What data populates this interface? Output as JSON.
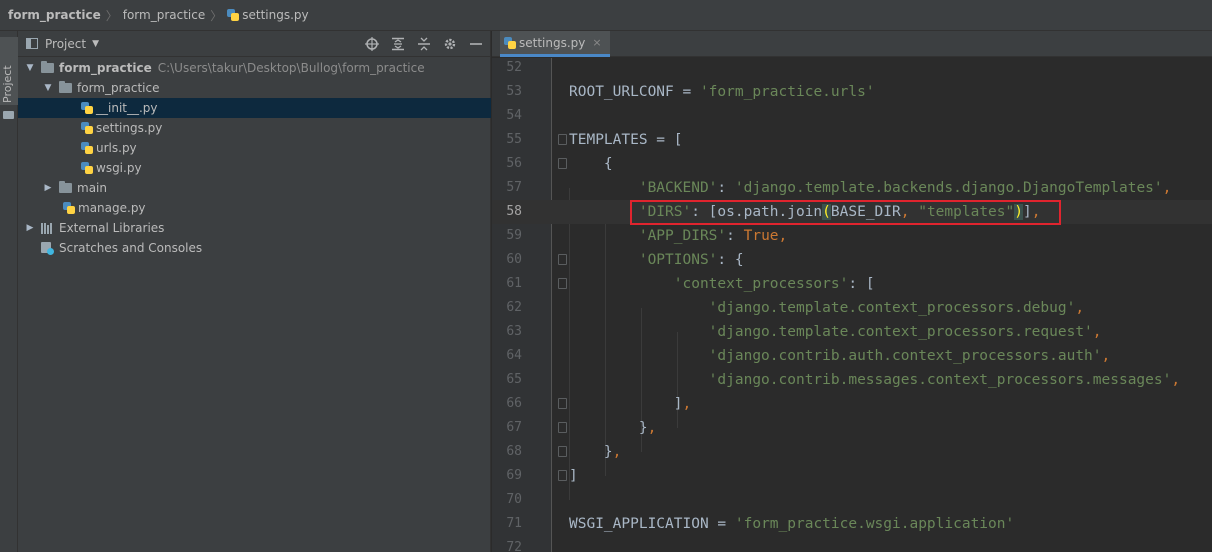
{
  "breadcrumb": {
    "project": "form_practice",
    "folder": "form_practice",
    "file": "settings.py"
  },
  "sidebar_stripe": {
    "label": "Project"
  },
  "project_panel": {
    "title": "Project",
    "tools": [
      "locate-icon",
      "expand-all-icon",
      "collapse-all-icon",
      "settings-gear-icon",
      "hide-icon"
    ],
    "tree": [
      {
        "label": "form_practice",
        "path": "C:\\Users\\takur\\Desktop\\Bullog\\form_practice",
        "type": "folder",
        "expanded": true
      },
      {
        "label": "form_practice",
        "type": "folder",
        "expanded": true
      },
      {
        "label": "__init__.py",
        "type": "python",
        "selected": true
      },
      {
        "label": "settings.py",
        "type": "python"
      },
      {
        "label": "urls.py",
        "type": "python"
      },
      {
        "label": "wsgi.py",
        "type": "python"
      },
      {
        "label": "main",
        "type": "folder",
        "expanded": false
      },
      {
        "label": "manage.py",
        "type": "python"
      },
      {
        "label": "External Libraries",
        "type": "library",
        "expanded": false
      },
      {
        "label": "Scratches and Consoles",
        "type": "scratch"
      }
    ]
  },
  "editor": {
    "tab": {
      "label": "settings.py",
      "close": "×"
    },
    "current_line": "58",
    "line_numbers": [
      "52",
      "53",
      "54",
      "55",
      "56",
      "57",
      "58",
      "59",
      "60",
      "61",
      "62",
      "63",
      "64",
      "65",
      "66",
      "67",
      "68",
      "69",
      "70",
      "71",
      "72"
    ],
    "lines": {
      "l53_a": "ROOT_URLCONF = ",
      "l53_b": "'form_practice.urls'",
      "l55": "TEMPLATES = [",
      "l56": "    {",
      "l57_a": "        'BACKEND'",
      "l57_b": ": ",
      "l57_c": "'django.template.backends.django.DjangoTemplates'",
      "l57_d": ",",
      "l58_a": "        'DIRS'",
      "l58_b": ": [os.path.join",
      "l58_c": "(",
      "l58_d": "BASE_DIR",
      "l58_e": ", ",
      "l58_f": "\"templates\"",
      "l58_g": ")",
      "l58_h": "]",
      "l58_i": ",",
      "l59_a": "        'APP_DIRS'",
      "l59_b": ": ",
      "l59_c": "True",
      "l59_d": ",",
      "l60_a": "        'OPTIONS'",
      "l60_b": ": {",
      "l61_a": "            'context_processors'",
      "l61_b": ": [",
      "l62_a": "                'django.template.context_processors.debug'",
      "l62_b": ",",
      "l63_a": "                'django.template.context_processors.request'",
      "l63_b": ",",
      "l64_a": "                'django.contrib.auth.context_processors.auth'",
      "l64_b": ",",
      "l65_a": "                'django.contrib.messages.context_processors.messages'",
      "l65_b": ",",
      "l66_a": "            ]",
      "l66_b": ",",
      "l67_a": "        }",
      "l67_b": ",",
      "l68_a": "    }",
      "l68_b": ",",
      "l69": "]",
      "l71_a": "WSGI_APPLICATION = ",
      "l71_b": "'form_practice.wsgi.application'"
    }
  },
  "colors": {
    "string": "#6a8759",
    "keyword": "#cc7832",
    "code": "#a9b7c6",
    "highlight_box": "#e0242e",
    "selection": "#0d293e",
    "tab_underline": "#4a88c7"
  }
}
